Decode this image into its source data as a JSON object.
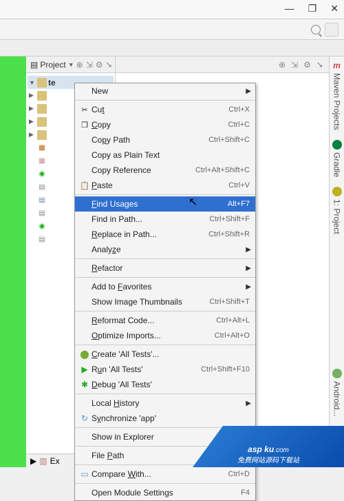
{
  "window": {
    "min": "—",
    "max": "❐",
    "close": "✕"
  },
  "pane": {
    "title": "Project",
    "ext_title": "Ex"
  },
  "tree": {
    "root": "te"
  },
  "side_tabs": {
    "maven": "Maven Projects",
    "gradle": "Gradle",
    "project": "1: Project",
    "android": "Android..."
  },
  "menu": [
    {
      "t": "item",
      "label": "New",
      "sub": true
    },
    {
      "t": "sep"
    },
    {
      "t": "item",
      "icon": "✂",
      "label": "Cut",
      "mn": "t",
      "sc": "Ctrl+X"
    },
    {
      "t": "item",
      "icon": "❐",
      "label": "Copy",
      "mn": "C",
      "sc": "Ctrl+C"
    },
    {
      "t": "item",
      "label": "Copy Path",
      "mn": "P",
      "sc": "Ctrl+Shift+C"
    },
    {
      "t": "item",
      "label": "Copy as Plain Text"
    },
    {
      "t": "item",
      "label": "Copy Reference",
      "sc": "Ctrl+Alt+Shift+C"
    },
    {
      "t": "item",
      "icon": "📋",
      "label": "Paste",
      "mn": "P",
      "sc": "Ctrl+V"
    },
    {
      "t": "sep"
    },
    {
      "t": "item",
      "label": "Find Usages",
      "mn": "F",
      "sc": "Alt+F7",
      "hl": true
    },
    {
      "t": "item",
      "label": "Find in Path...",
      "sc": "Ctrl+Shift+F"
    },
    {
      "t": "item",
      "label": "Replace in Path...",
      "mn": "R",
      "sc": "Ctrl+Shift+R"
    },
    {
      "t": "item",
      "label": "Analyze",
      "mn": "z",
      "sub": true
    },
    {
      "t": "sep"
    },
    {
      "t": "item",
      "label": "Refactor",
      "mn": "R",
      "sub": true
    },
    {
      "t": "sep"
    },
    {
      "t": "item",
      "label": "Add to Favorites",
      "mn": "F",
      "sub": true
    },
    {
      "t": "item",
      "label": "Show Image Thumbnails",
      "sc": "Ctrl+Shift+T"
    },
    {
      "t": "sep"
    },
    {
      "t": "item",
      "label": "Reformat Code...",
      "mn": "R",
      "sc": "Ctrl+Alt+L"
    },
    {
      "t": "item",
      "label": "Optimize Imports...",
      "mn": "O",
      "sc": "Ctrl+Alt+O"
    },
    {
      "t": "sep"
    },
    {
      "t": "item",
      "icon": "droid",
      "label": "Create 'All Tests'...",
      "mn": "C"
    },
    {
      "t": "item",
      "icon": "run",
      "label": "Run 'All Tests'",
      "mn": "u",
      "sc": "Ctrl+Shift+F10"
    },
    {
      "t": "item",
      "icon": "bug",
      "label": "Debug 'All Tests'",
      "mn": "D"
    },
    {
      "t": "sep"
    },
    {
      "t": "item",
      "label": "Local History",
      "mn": "H",
      "sub": true
    },
    {
      "t": "item",
      "icon": "sync",
      "label": "Synchronize 'app'",
      "mn": "y"
    },
    {
      "t": "sep"
    },
    {
      "t": "item",
      "label": "Show in Explorer"
    },
    {
      "t": "sep"
    },
    {
      "t": "item",
      "label": "File Path",
      "mn": "P",
      "sc": "Ctrl+Alt+F12"
    },
    {
      "t": "sep"
    },
    {
      "t": "item",
      "icon": "cmp",
      "label": "Compare With...",
      "mn": "W",
      "sc": "Ctrl+D"
    },
    {
      "t": "sep"
    },
    {
      "t": "item",
      "label": "Open Module Settings",
      "sc": "F4"
    }
  ],
  "watermark": {
    "brand": "asp ku",
    "sub1": ".com",
    "sub2": "免费网站源码下载站"
  }
}
